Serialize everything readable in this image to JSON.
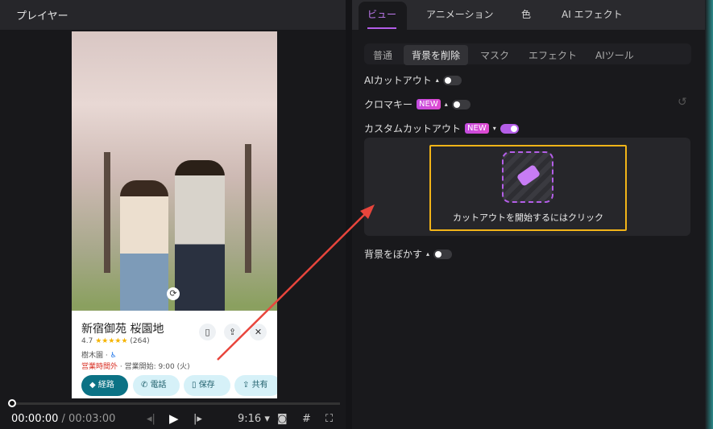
{
  "player": {
    "title": "プレイヤー",
    "current_time": "00:00:00",
    "total_time": "/ 00:03:00",
    "aspect": "9:16",
    "progress": 0
  },
  "place_card": {
    "name": "新宿御苑 桜園地",
    "rating": "4.7",
    "stars": "★★★★★",
    "reviews": "(264)",
    "category": "樹木園 ·",
    "status": "営業時間外",
    "hours": "· 営業開始: 9:00 (火)",
    "actions": [
      "経路",
      "電話",
      "保存",
      "共有"
    ]
  },
  "tabs": [
    "ビュー",
    "アニメーション",
    "色",
    "AI エフェクト"
  ],
  "subtabs": [
    "普通",
    "背景を削除",
    "マスク",
    "エフェクト",
    "AIツール"
  ],
  "options": {
    "ai_cutout": "AIカットアウト",
    "chroma": "クロマキー",
    "custom": "カスタムカットアウト",
    "new_badge": "NEW",
    "blur": "背景をぼかす"
  },
  "cutout_prompt": "カットアウトを開始するにはクリック",
  "colors": {
    "accent": "#b45ee8",
    "highlight": "#f2b418",
    "arrow": "#e8453c"
  }
}
